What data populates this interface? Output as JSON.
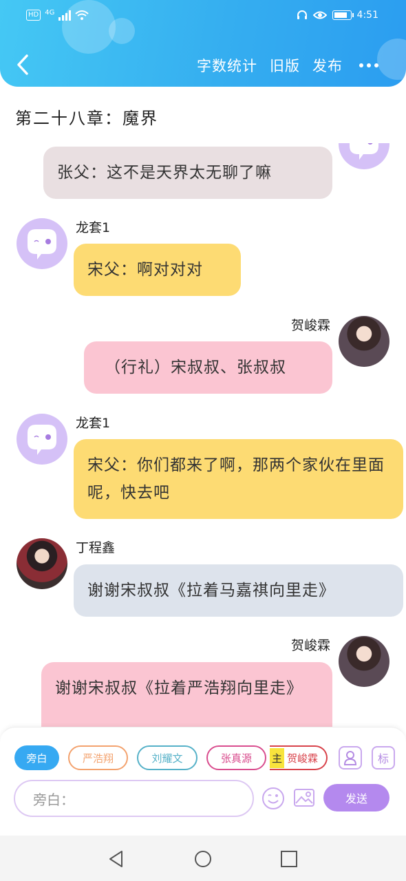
{
  "status_bar": {
    "hd": "HD",
    "network": "4G",
    "time": "4:51"
  },
  "toolbar": {
    "word_count": "字数统计",
    "old_version": "旧版",
    "publish": "发布"
  },
  "chapter_title": "第二十八章：魔界",
  "messages": [
    {
      "side": "right",
      "avatar": "purple-mascot",
      "sender": "",
      "text": "张父：这不是天界太无聊了嘛",
      "color": "#e9dfe1"
    },
    {
      "side": "left",
      "avatar": "purple-mascot",
      "sender": "龙套1",
      "text": "宋父：啊对对对",
      "color": "#fddb73"
    },
    {
      "side": "right",
      "avatar": "photo",
      "sender": "贺峻霖",
      "text": "（行礼）宋叔叔、张叔叔",
      "color": "#fbc5d2"
    },
    {
      "side": "left",
      "avatar": "purple-mascot",
      "sender": "龙套1",
      "text": "宋父：你们都来了啊，那两个家伙在里面呢，快去吧",
      "color": "#fddb73"
    },
    {
      "side": "left",
      "avatar": "photo",
      "sender": "丁程鑫",
      "text": "谢谢宋叔叔《拉着马嘉祺向里走》",
      "color": "#dde3ec"
    },
    {
      "side": "right",
      "avatar": "photo",
      "sender": "贺峻霖",
      "text": "谢谢宋叔叔《拉着严浩翔向里走》",
      "color": "#fbc5d2"
    }
  ],
  "roles": [
    {
      "label": "旁白",
      "selected": true,
      "color": "#36a9f2"
    },
    {
      "label": "严浩翔",
      "selected": false,
      "color": "#f3a26e"
    },
    {
      "label": "刘耀文",
      "selected": false,
      "color": "#55b1c8"
    },
    {
      "label": "张真源",
      "selected": false,
      "color": "#d94d8e"
    },
    {
      "label": "贺峻霖",
      "selected": false,
      "color": "#d8424a",
      "main_tag": "主"
    }
  ],
  "input": {
    "value": "旁白：",
    "send_label": "发送",
    "tag_label": "标"
  },
  "icons": [
    "status-bar-icons",
    "back-arrow-icon",
    "more-icon",
    "mascot-icon",
    "user-icon",
    "tag-icon",
    "emoji-icon",
    "image-icon",
    "nav-back-icon",
    "nav-home-icon",
    "nav-recents-icon"
  ]
}
